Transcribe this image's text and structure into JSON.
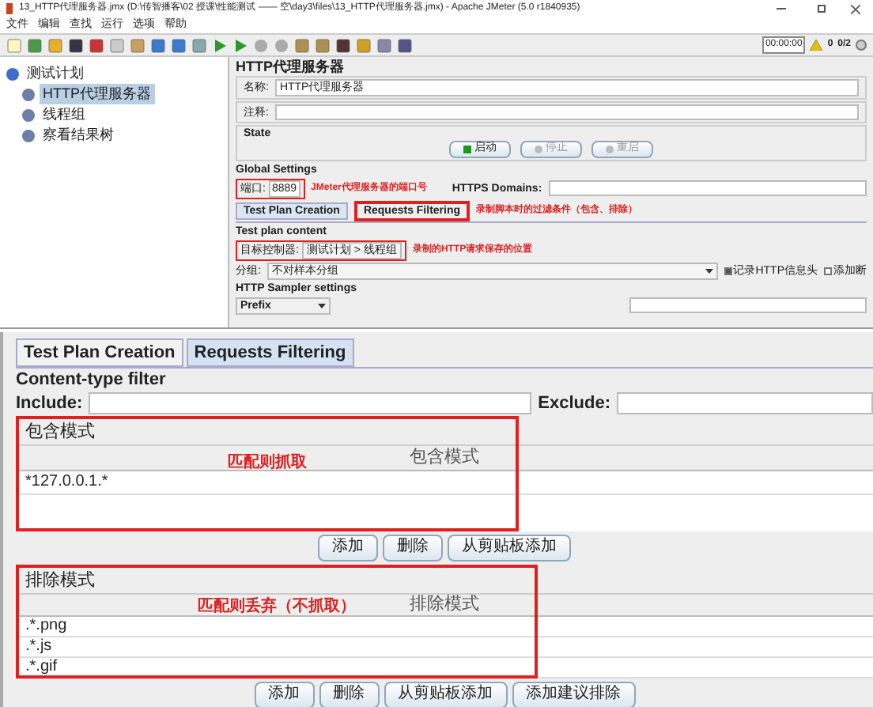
{
  "top_window": {
    "title": "13_HTTP代理服务器.jmx (D:\\传智播客\\02 授课\\性能测试 —— 空\\day3\\files\\13_HTTP代理服务器.jmx) - Apache JMeter (5.0 r1840935)",
    "menu": [
      "文件",
      "编辑",
      "查找",
      "运行",
      "选项",
      "帮助"
    ],
    "timer": "00:00:00",
    "warnings": "0",
    "threads": "0/2",
    "tree": [
      {
        "label": "测试计划",
        "selected": false,
        "children": [
          {
            "label": "HTTP代理服务器",
            "selected": true
          },
          {
            "label": "线程组",
            "selected": false
          },
          {
            "label": "察看结果树",
            "selected": false
          }
        ]
      }
    ],
    "panel": {
      "title": "HTTP代理服务器",
      "name_label": "名称:",
      "name_value": "HTTP代理服务器",
      "comment_label": "注释:",
      "state_title": "State",
      "state_buttons": [
        {
          "label": "启动",
          "disabled": false
        },
        {
          "label": "停止",
          "disabled": true
        },
        {
          "label": "重启",
          "disabled": true
        }
      ],
      "global_title": "Global Settings",
      "port_label": "端口:",
      "port_value": "8889",
      "port_note": "JMeter代理服务器的端口号",
      "https_label": "HTTPS Domains:",
      "tabs": [
        {
          "label": "Test Plan Creation",
          "selected": true
        },
        {
          "label": "Requests Filtering",
          "selected": false
        }
      ],
      "tabs_note": "录制脚本时的过滤条件（包含、排除）",
      "content_title": "Test plan content",
      "target_label": "目标控制器:",
      "target_value": "测试计划 > 线程组",
      "target_note": "录制的HTTP请求保存的位置",
      "group_label": "分组:",
      "group_value": "不对样本分组",
      "checkboxes": [
        {
          "label": "记录HTTP信息头",
          "checked": true
        },
        {
          "label": "添加断",
          "checked": false
        }
      ],
      "sampler_title": "HTTP Sampler settings",
      "prefix_value": "Prefix"
    }
  },
  "zoomed_panel": {
    "tabs": [
      {
        "label": "Test Plan Creation",
        "selected": false
      },
      {
        "label": "Requests Filtering",
        "selected": true
      }
    ],
    "filter_title": "Content-type filter",
    "include_label": "Include:",
    "exclude_label": "Exclude:",
    "sections": [
      {
        "title": "包含模式",
        "column": "包含模式",
        "note": "匹配则抓取",
        "rows": [
          "*127.0.0.1.*"
        ],
        "buttons": [
          "添加",
          "删除",
          "从剪贴板添加"
        ]
      },
      {
        "title": "排除模式",
        "column": "排除模式",
        "note": "匹配则丢弃（不抓取）",
        "rows": [
          ".*.png",
          ".*.js",
          ".*.gif"
        ],
        "buttons": [
          "添加",
          "删除",
          "从剪贴板添加",
          "添加建议排除"
        ]
      }
    ]
  }
}
